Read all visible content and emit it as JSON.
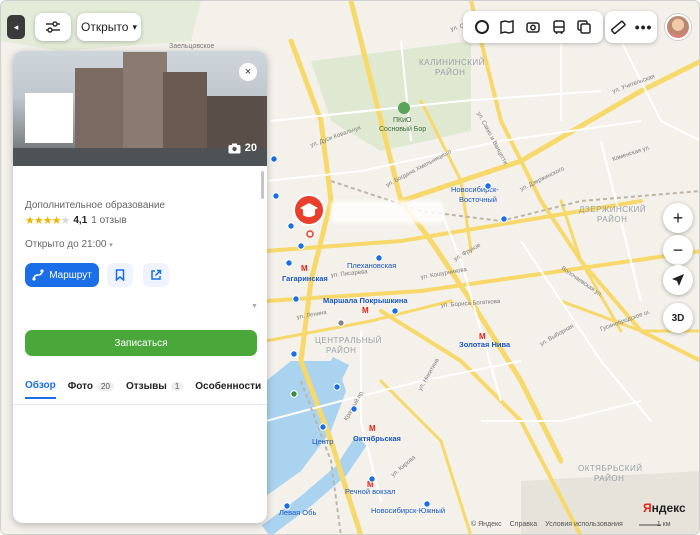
{
  "map": {
    "districts": [
      {
        "text": "КАЛИНИНСКИЙ"
      },
      {
        "text": "РАЙОН"
      },
      {
        "text": "ДЗЕРЖИНСКИЙ"
      },
      {
        "text": "РАЙОН"
      },
      {
        "text": "ЦЕНТРАЛЬНЫЙ"
      },
      {
        "text": "РАЙОН"
      },
      {
        "text": "ОКТЯБРЬСКИЙ"
      },
      {
        "text": "РАЙОН"
      }
    ],
    "stations": [
      {
        "text": "Гагаринская"
      },
      {
        "text": "Маршала Покрышкина"
      },
      {
        "text": "Золотая Нива"
      },
      {
        "text": "Октябрьская"
      }
    ],
    "places": [
      {
        "text": "Плехановская"
      },
      {
        "text": "Новосибирск-"
      },
      {
        "text": "Восточный"
      },
      {
        "text": "Центр"
      },
      {
        "text": "Речной вокзал"
      },
      {
        "text": "Новосибирск-Южный"
      },
      {
        "text": "Левая Обь"
      },
      {
        "text": "ПКиО"
      },
      {
        "text": "Сосновый Бор"
      },
      {
        "text": "Заельцовское"
      }
    ],
    "streets": [
      {
        "text": "ул. Дуси Ковальчук"
      },
      {
        "text": "ул. Богдана Хмельницкого"
      },
      {
        "text": "ул. Писарева"
      },
      {
        "text": "ул. Дзержинского"
      },
      {
        "text": "ул. Кошурникова"
      },
      {
        "text": "Гусинобродское ш."
      },
      {
        "text": "Волочаевская ул."
      },
      {
        "text": "ул. Бориса Богаткова"
      },
      {
        "text": "Красный пр."
      },
      {
        "text": "ул. Фрунзе"
      },
      {
        "text": "ул. Кирова"
      },
      {
        "text": "ул. Выборная"
      },
      {
        "text": "ул. Учительская"
      },
      {
        "text": "ул. Объединения"
      },
      {
        "text": "ул. Ленина"
      },
      {
        "text": "Каменская ул."
      },
      {
        "text": "ул. Никитина"
      },
      {
        "text": "ул. Сакко и Ванцетти"
      }
    ]
  },
  "toolbar": {
    "collapse": "◂",
    "open_filter": "Открыто",
    "caret": "▾"
  },
  "controls": {
    "zoom_in": "+",
    "zoom_out": "−",
    "three_d": "3D"
  },
  "card": {
    "photo_count": "20",
    "close": "×",
    "category": "Дополнительное образование",
    "rating": "4,1",
    "rating_stars": 4.1,
    "reviews": "1 отзыв",
    "hours": "Открыто до 21:00",
    "hours_caret": "▾",
    "route_label": "Маршрут",
    "signup_label": "Записаться",
    "tabs": [
      {
        "label": "Обзор",
        "badge": ""
      },
      {
        "label": "Фото",
        "badge": "20"
      },
      {
        "label": "Отзывы",
        "badge": "1"
      },
      {
        "label": "Особенности",
        "badge": ""
      }
    ]
  },
  "footer": {
    "copyright": "© Яндекс",
    "help": "Справка",
    "terms": "Условия использования",
    "scale": "1 км"
  },
  "logo": {
    "first": "Я",
    "rest": "ндекс"
  },
  "colors": {
    "accent_blue": "#1a6ee8",
    "signup_green": "#4aa83a",
    "marker_red": "#e8402d",
    "metro_red": "#e62117",
    "arrow_red": "#e8402d"
  }
}
